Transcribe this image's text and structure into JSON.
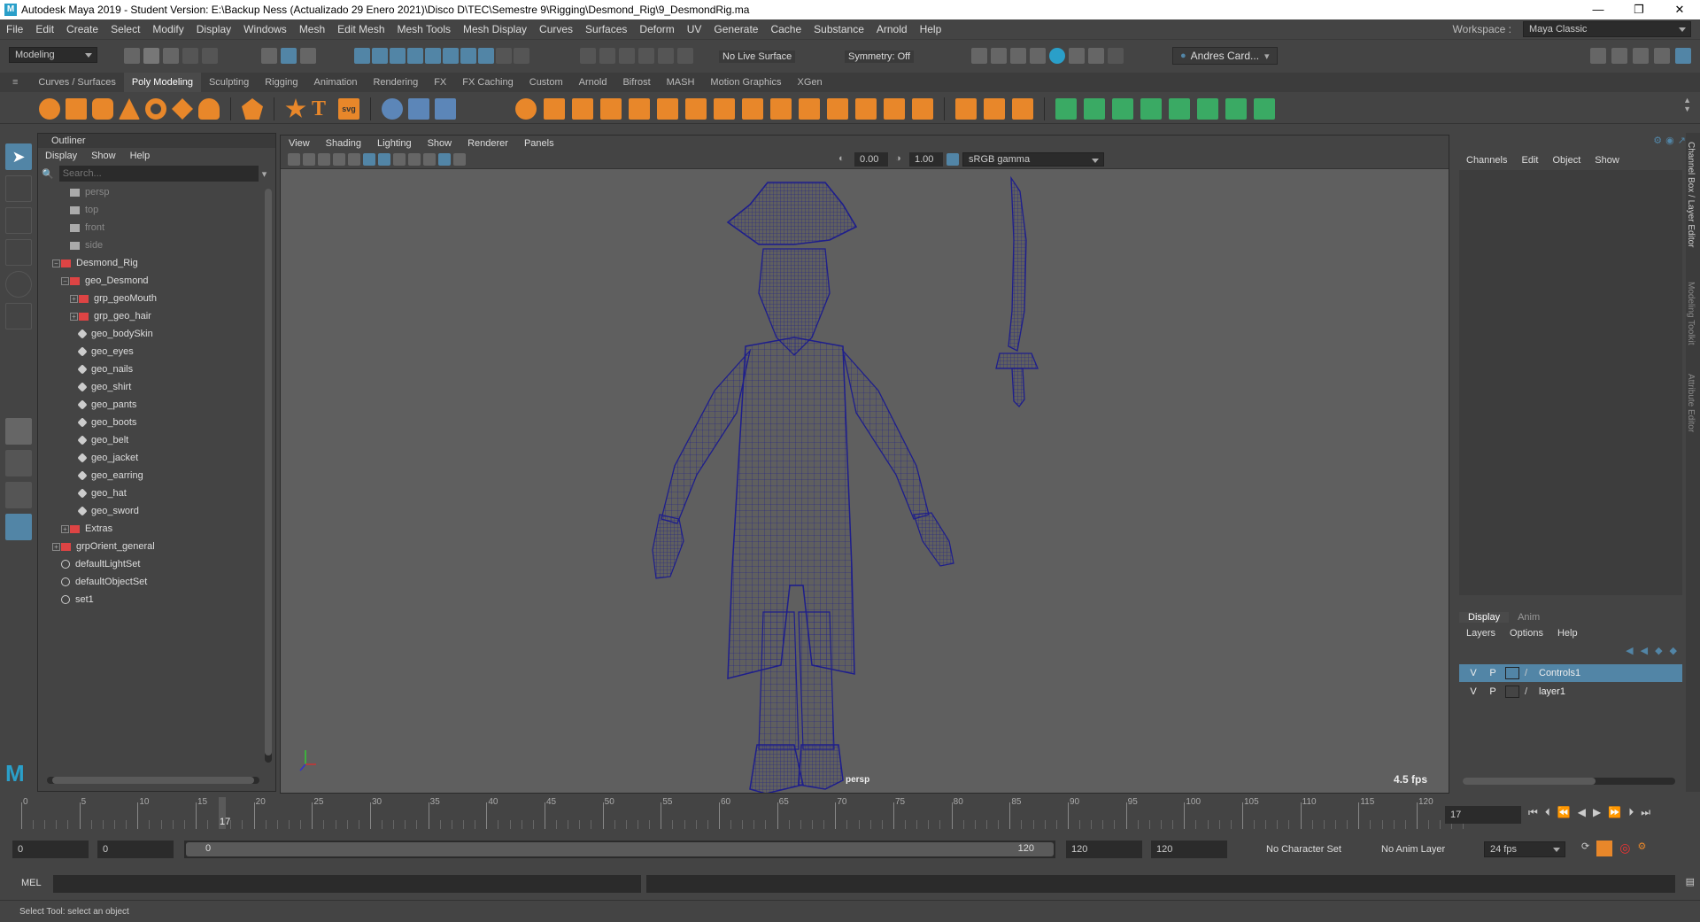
{
  "titlebar": {
    "title": "Autodesk Maya 2019 - Student Version: E:\\Backup Ness (Actualizado 29 Enero 2021)\\Disco D\\TEC\\Semestre 9\\Rigging\\Desmond_Rig\\9_DesmondRig.ma",
    "minimize": "—",
    "restore": "❐",
    "close": "✕"
  },
  "menubar": {
    "items": [
      "File",
      "Edit",
      "Create",
      "Select",
      "Modify",
      "Display",
      "Windows",
      "Mesh",
      "Edit Mesh",
      "Mesh Tools",
      "Mesh Display",
      "Curves",
      "Surfaces",
      "Deform",
      "UV",
      "Generate",
      "Cache",
      "Substance",
      "Arnold",
      "Help"
    ],
    "workspace_label": "Workspace :",
    "workspace_value": "Maya Classic"
  },
  "statusline": {
    "mode": "Modeling",
    "live_surface": "No Live Surface",
    "symmetry": "Symmetry: Off",
    "user": "Andres Card..."
  },
  "shelf": {
    "tabs": [
      "Curves / Surfaces",
      "Poly Modeling",
      "Sculpting",
      "Rigging",
      "Animation",
      "Rendering",
      "FX",
      "FX Caching",
      "Custom",
      "Arnold",
      "Bifrost",
      "MASH",
      "Motion Graphics",
      "XGen"
    ],
    "active": "Poly Modeling"
  },
  "outliner": {
    "title": "Outliner",
    "menu": [
      "Display",
      "Show",
      "Help"
    ],
    "search_placeholder": "Search...",
    "items": [
      {
        "label": "persp",
        "type": "camera"
      },
      {
        "label": "top",
        "type": "camera"
      },
      {
        "label": "front",
        "type": "camera"
      },
      {
        "label": "side",
        "type": "camera"
      },
      {
        "label": "Desmond_Rig",
        "type": "group"
      },
      {
        "label": "geo_Desmond",
        "type": "group"
      },
      {
        "label": "grp_geoMouth",
        "type": "group"
      },
      {
        "label": "grp_geo_hair",
        "type": "group"
      },
      {
        "label": "geo_bodySkin",
        "type": "mesh"
      },
      {
        "label": "geo_eyes",
        "type": "mesh"
      },
      {
        "label": "geo_nails",
        "type": "mesh"
      },
      {
        "label": "geo_shirt",
        "type": "mesh"
      },
      {
        "label": "geo_pants",
        "type": "mesh"
      },
      {
        "label": "geo_boots",
        "type": "mesh"
      },
      {
        "label": "geo_belt",
        "type": "mesh"
      },
      {
        "label": "geo_jacket",
        "type": "mesh"
      },
      {
        "label": "geo_earring",
        "type": "mesh"
      },
      {
        "label": "geo_hat",
        "type": "mesh"
      },
      {
        "label": "geo_sword",
        "type": "mesh"
      },
      {
        "label": "Extras",
        "type": "group"
      },
      {
        "label": "grpOrient_general",
        "type": "group"
      },
      {
        "label": "defaultLightSet",
        "type": "set"
      },
      {
        "label": "defaultObjectSet",
        "type": "set"
      },
      {
        "label": "set1",
        "type": "set"
      }
    ]
  },
  "viewport": {
    "menu": [
      "View",
      "Shading",
      "Lighting",
      "Show",
      "Renderer",
      "Panels"
    ],
    "value_a": "0.00",
    "value_b": "1.00",
    "color_space": "sRGB gamma",
    "camera": "persp",
    "fps": "4.5 fps"
  },
  "channelbox": {
    "menu": [
      "Channels",
      "Edit",
      "Object",
      "Show"
    ],
    "side_tabs": [
      "Channel Box / Layer Editor",
      "Modeling Toolkit",
      "Attribute Editor"
    ]
  },
  "layers": {
    "tabs": [
      "Display",
      "Anim"
    ],
    "menu": [
      "Layers",
      "Options",
      "Help"
    ],
    "rows": [
      {
        "v": "V",
        "p": "P",
        "name": "Controls1",
        "selected": true
      },
      {
        "v": "V",
        "p": "P",
        "name": "layer1",
        "selected": false
      }
    ]
  },
  "timeline": {
    "ticks": [
      "0",
      "5",
      "10",
      "15",
      "20",
      "25",
      "30",
      "35",
      "40",
      "45",
      "50",
      "55",
      "60",
      "65",
      "70",
      "75",
      "80",
      "85",
      "90",
      "95",
      "100",
      "105",
      "110",
      "115",
      "120"
    ],
    "current": "17",
    "current_frame_field": "17"
  },
  "range": {
    "start": "0",
    "anim_start": "0",
    "slider_start": "0",
    "slider_end": "120",
    "anim_end": "120",
    "end": "120",
    "character_set": "No Character Set",
    "anim_layer": "No Anim Layer",
    "fps": "24 fps"
  },
  "mel": {
    "label": "MEL"
  },
  "helpline": {
    "text": "Select Tool: select an object"
  },
  "colors": {
    "accent": "#5285a6",
    "wire": "#1e1e8c",
    "selected_row": "#5285a6"
  }
}
